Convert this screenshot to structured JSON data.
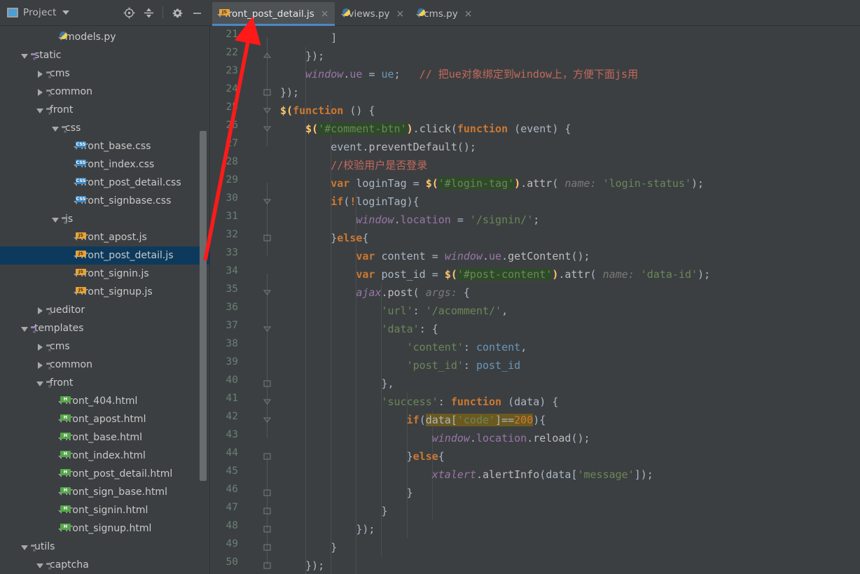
{
  "panel": {
    "title": "Project",
    "icons": [
      {
        "name": "locate-icon",
        "glyph": "target"
      },
      {
        "name": "collapse-all-icon",
        "glyph": "collapse"
      },
      {
        "name": "settings-gear-icon",
        "glyph": "gear"
      },
      {
        "name": "minimize-icon",
        "glyph": "minus"
      }
    ]
  },
  "tabs": [
    {
      "label": "front_post_detail.js",
      "icon": "js-file-icon",
      "active": true,
      "close": "×"
    },
    {
      "label": "views.py",
      "icon": "py-file-icon",
      "active": false,
      "close": "×"
    },
    {
      "label": "cms.py",
      "icon": "py-file-icon",
      "active": false,
      "close": "×"
    }
  ],
  "tree": [
    {
      "indent": 3,
      "arrow": "none",
      "icon": "py",
      "label": "models.py",
      "selected": false
    },
    {
      "indent": 1,
      "arrow": "d",
      "icon": "folderp",
      "label": "static",
      "selected": false
    },
    {
      "indent": 2,
      "arrow": "r",
      "icon": "folder",
      "label": "cms",
      "selected": false
    },
    {
      "indent": 2,
      "arrow": "r",
      "icon": "folder",
      "label": "common",
      "selected": false
    },
    {
      "indent": 2,
      "arrow": "d",
      "icon": "folder",
      "label": "front",
      "selected": false
    },
    {
      "indent": 3,
      "arrow": "d",
      "icon": "folder",
      "label": "css",
      "selected": false
    },
    {
      "indent": 4,
      "arrow": "none",
      "icon": "css",
      "label": "front_base.css",
      "selected": false
    },
    {
      "indent": 4,
      "arrow": "none",
      "icon": "css",
      "label": "front_index.css",
      "selected": false
    },
    {
      "indent": 4,
      "arrow": "none",
      "icon": "css",
      "label": "front_post_detail.css",
      "selected": false
    },
    {
      "indent": 4,
      "arrow": "none",
      "icon": "css",
      "label": "front_signbase.css",
      "selected": false
    },
    {
      "indent": 3,
      "arrow": "d",
      "icon": "folder",
      "label": "js",
      "selected": false
    },
    {
      "indent": 4,
      "arrow": "none",
      "icon": "js",
      "label": "front_apost.js",
      "selected": false
    },
    {
      "indent": 4,
      "arrow": "none",
      "icon": "js",
      "label": "front_post_detail.js",
      "selected": true
    },
    {
      "indent": 4,
      "arrow": "none",
      "icon": "js",
      "label": "front_signin.js",
      "selected": false
    },
    {
      "indent": 4,
      "arrow": "none",
      "icon": "js",
      "label": "front_signup.js",
      "selected": false
    },
    {
      "indent": 2,
      "arrow": "r",
      "icon": "folder",
      "label": "ueditor",
      "selected": false
    },
    {
      "indent": 1,
      "arrow": "d",
      "icon": "folderp",
      "label": "templates",
      "selected": false
    },
    {
      "indent": 2,
      "arrow": "r",
      "icon": "folder",
      "label": "cms",
      "selected": false
    },
    {
      "indent": 2,
      "arrow": "r",
      "icon": "folder",
      "label": "common",
      "selected": false
    },
    {
      "indent": 2,
      "arrow": "d",
      "icon": "folder",
      "label": "front",
      "selected": false
    },
    {
      "indent": 3,
      "arrow": "none",
      "icon": "html",
      "label": "front_404.html",
      "selected": false
    },
    {
      "indent": 3,
      "arrow": "none",
      "icon": "html",
      "label": "front_apost.html",
      "selected": false
    },
    {
      "indent": 3,
      "arrow": "none",
      "icon": "html",
      "label": "front_base.html",
      "selected": false
    },
    {
      "indent": 3,
      "arrow": "none",
      "icon": "html",
      "label": "front_index.html",
      "selected": false
    },
    {
      "indent": 3,
      "arrow": "none",
      "icon": "html",
      "label": "front_post_detail.html",
      "selected": false
    },
    {
      "indent": 3,
      "arrow": "none",
      "icon": "html",
      "label": "front_sign_base.html",
      "selected": false
    },
    {
      "indent": 3,
      "arrow": "none",
      "icon": "html",
      "label": "front_signin.html",
      "selected": false
    },
    {
      "indent": 3,
      "arrow": "none",
      "icon": "html",
      "label": "front_signup.html",
      "selected": false
    },
    {
      "indent": 1,
      "arrow": "d",
      "icon": "folder",
      "label": "utils",
      "selected": false
    },
    {
      "indent": 2,
      "arrow": "d",
      "icon": "folder",
      "label": "captcha",
      "selected": false
    }
  ],
  "editor": {
    "first_line": 21,
    "last_line": 50,
    "line_numbers": [
      21,
      22,
      23,
      24,
      25,
      26,
      27,
      28,
      29,
      30,
      31,
      32,
      33,
      34,
      35,
      36,
      37,
      38,
      39,
      40,
      41,
      42,
      43,
      44,
      45,
      46,
      47,
      48,
      49,
      50
    ],
    "lines": [
      "        ]",
      "    });",
      "    window.ue = ue;   // 把ue对象绑定到window上，方便下面js用",
      "});",
      "$(function () {",
      "    $('#comment-btn').click(function (event) {",
      "        event.preventDefault();",
      "        //校验用户是否登录",
      "        var loginTag = $('#login-tag').attr( name: 'login-status');",
      "        if(!loginTag){",
      "            window.location = '/signin/';",
      "        }else{",
      "            var content = window.ue.getContent();",
      "            var post_id = $('#post-content').attr( name: 'data-id');",
      "            ajax.post( args: {",
      "                'url': '/acomment/',",
      "                'data': {",
      "                    'content': content,",
      "                    'post_id': post_id",
      "                },",
      "                'success': function (data) {",
      "                    if(data['code']==200){",
      "                        window.location.reload();",
      "                    }else{",
      "                        xtalert.alertInfo(data['message']);",
      "                    }",
      "                }",
      "            });",
      "        }",
      "    });"
    ],
    "comments": {
      "line23": "// 把ue对象绑定到window上，方便下面js用",
      "line28": "//校验用户是否登录"
    },
    "param_hints": [
      "name:",
      "name:",
      "args:"
    ],
    "highlighted_token": "data['code']==200"
  },
  "annotation": {
    "type": "arrow",
    "color": "#ff1a1a",
    "points_from": [
      293,
      372
    ],
    "points_to": [
      358,
      38
    ]
  },
  "colors": {
    "background": "#3c3f41",
    "selection": "#0d3a5c",
    "accent": "#4a88c7",
    "keyword": "#cc7832",
    "string": "#6a8759",
    "number": "#6897bb",
    "function": "#ffc66d",
    "comment_red": "#c4695e",
    "global": "#9876aa",
    "line_number": "#6a8076"
  }
}
